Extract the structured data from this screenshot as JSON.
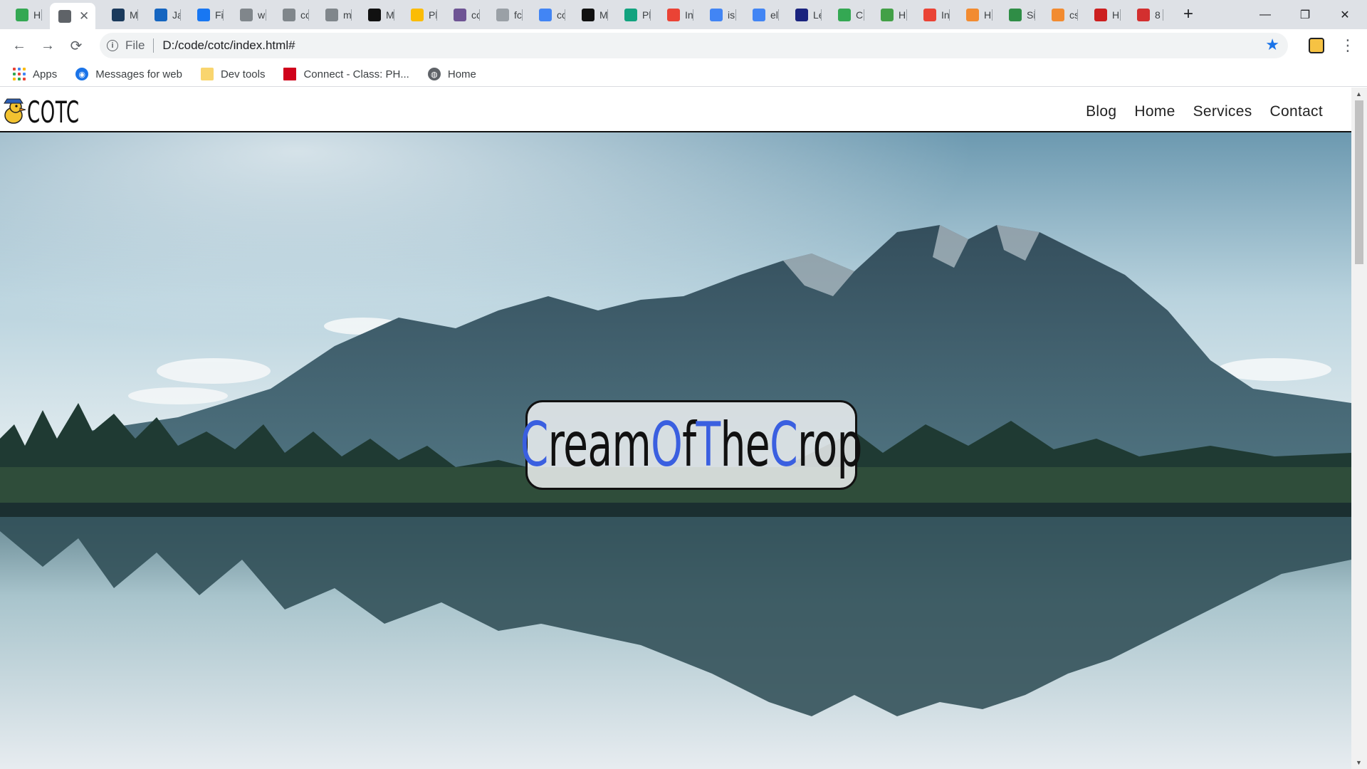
{
  "browser": {
    "tabs": [
      {
        "title": "H",
        "favicon": "green-table-favicon",
        "color": "#34a853"
      },
      {
        "title": "",
        "favicon": "globe-favicon",
        "color": "#5f6368",
        "active": true
      },
      {
        "title": "M",
        "favicon": "dark-badge-favicon",
        "color": "#1b3a5c"
      },
      {
        "title": "Ja",
        "favicon": "blue-q-favicon",
        "color": "#1565c0"
      },
      {
        "title": "Fi",
        "favicon": "blue-f-favicon",
        "color": "#1877f2"
      },
      {
        "title": "w",
        "favicon": "grey-square-favicon",
        "color": "#80868b"
      },
      {
        "title": "cc",
        "favicon": "globe-favicon",
        "color": "#80868b"
      },
      {
        "title": "m",
        "favicon": "globe-favicon",
        "color": "#80868b"
      },
      {
        "title": "M",
        "favicon": "medium-favicon",
        "color": "#111111"
      },
      {
        "title": "Pl",
        "favicon": "chrome-favicon",
        "color": "#fbbc05"
      },
      {
        "title": "cc",
        "favicon": "github-favicon",
        "color": "#6e5494"
      },
      {
        "title": "fc",
        "favicon": "grey-f-favicon",
        "color": "#9aa0a6"
      },
      {
        "title": "cc",
        "favicon": "google-favicon",
        "color": "#4285f4"
      },
      {
        "title": "M",
        "favicon": "medium-favicon",
        "color": "#111111"
      },
      {
        "title": "Pl",
        "favicon": "teal-d-favicon",
        "color": "#12a37f"
      },
      {
        "title": "In",
        "favicon": "gmail-favicon",
        "color": "#ea4335"
      },
      {
        "title": "is",
        "favicon": "google-favicon",
        "color": "#4285f4"
      },
      {
        "title": "el",
        "favicon": "google-favicon",
        "color": "#4285f4"
      },
      {
        "title": "Le",
        "favicon": "navy-c-favicon",
        "color": "#1a237e"
      },
      {
        "title": "C",
        "favicon": "green-table-favicon",
        "color": "#34a853"
      },
      {
        "title": "H",
        "favicon": "green-node-favicon",
        "color": "#43a047"
      },
      {
        "title": "In",
        "favicon": "gmail-favicon",
        "color": "#ea4335"
      },
      {
        "title": "H",
        "favicon": "orange-hand-favicon",
        "color": "#f28b30"
      },
      {
        "title": "Si",
        "favicon": "gfg-favicon",
        "color": "#2f8d46"
      },
      {
        "title": "cs",
        "favicon": "orange-hand-favicon",
        "color": "#f28b30"
      },
      {
        "title": "H",
        "favicon": "opera-favicon",
        "color": "#cc1f1f"
      },
      {
        "title": "8",
        "favicon": "red-circle-favicon",
        "color": "#d32f2f"
      }
    ],
    "new_tab_label": "+",
    "window_controls": {
      "minimize": "—",
      "restore": "❐",
      "close": "✕"
    },
    "nav": {
      "back": "←",
      "forward": "→",
      "reload": "⟳"
    },
    "address": {
      "scheme": "File",
      "url": "D:/code/cotc/index.html#"
    },
    "bookmarks": [
      {
        "label": "Apps",
        "icon": "apps-grid-icon"
      },
      {
        "label": "Messages for web",
        "icon": "messages-icon"
      },
      {
        "label": "Dev tools",
        "icon": "folder-icon"
      },
      {
        "label": "Connect - Class: PH...",
        "icon": "mcgraw-hill-icon"
      },
      {
        "label": "Home",
        "icon": "globe-icon"
      }
    ]
  },
  "site": {
    "logo_text": "COTC",
    "nav_links": [
      "Blog",
      "Home",
      "Services",
      "Contact"
    ],
    "hero_title_parts": [
      {
        "text": "C",
        "accent": true
      },
      {
        "text": "ream",
        "accent": false
      },
      {
        "text": "O",
        "accent": true
      },
      {
        "text": "f",
        "accent": false
      },
      {
        "text": "T",
        "accent": true
      },
      {
        "text": "he",
        "accent": false
      },
      {
        "text": "C",
        "accent": true
      },
      {
        "text": "rop",
        "accent": false
      }
    ],
    "accent_color": "#3a5fe0"
  }
}
